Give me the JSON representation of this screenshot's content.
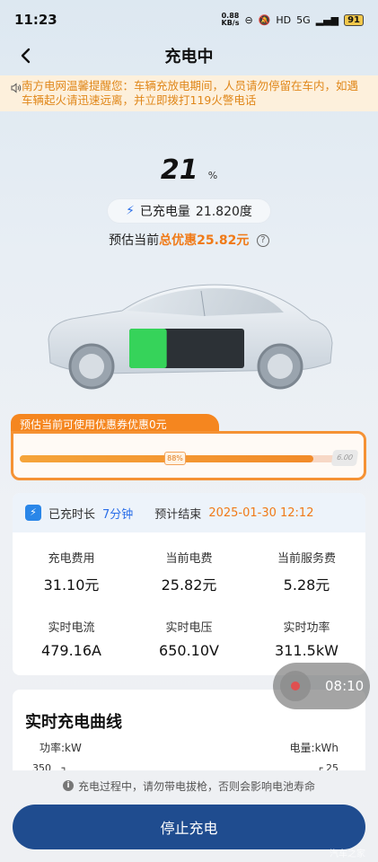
{
  "status_bar": {
    "time": "11:23",
    "net_speed": "0.88",
    "net_unit": "KB/s",
    "hd": "HD",
    "signal": "5G",
    "battery": "91"
  },
  "nav": {
    "title": "充电中"
  },
  "notice": {
    "text": "南方电网温馨提醒您：车辆充放电期间，人员请勿停留在车内，如遇车辆起火请迅速远离，并立即拨打119火警电话"
  },
  "charge": {
    "percent": "21",
    "percent_unit": "%",
    "charged_label": "已充电量",
    "charged_value": "21.820度",
    "discount_prefix": "预估当前",
    "discount_highlight": "总优惠25.82元",
    "battery_level": 0.21
  },
  "coupon": {
    "tab_text": "预估当前可使用优惠券优惠0元",
    "progress_label": "88%",
    "progress_fraction": 0.88,
    "end_label": "6.00"
  },
  "stats": {
    "duration_label": "已充时长",
    "duration_value": "7分钟",
    "end_label": "预计结束",
    "end_value": "2025-01-30 12:12",
    "items": [
      {
        "label": "充电费用",
        "value": "31.10元"
      },
      {
        "label": "当前电费",
        "value": "25.82元"
      },
      {
        "label": "当前服务费",
        "value": "5.28元"
      },
      {
        "label": "实时电流",
        "value": "479.16A"
      },
      {
        "label": "实时电压",
        "value": "650.10V"
      },
      {
        "label": "实时功率",
        "value": "311.5kW"
      }
    ]
  },
  "curve": {
    "title": "实时充电曲线",
    "left_axis": "功率:kW",
    "right_axis": "电量:kWh",
    "left_top_tick": "350",
    "right_top_tick": "25"
  },
  "timer": {
    "time": "08:10"
  },
  "tip": {
    "text": "充电过程中，请勿带电拔枪，否则会影响电池寿命"
  },
  "actions": {
    "stop_label": "停止充电"
  },
  "watermark": "汽车之家"
}
